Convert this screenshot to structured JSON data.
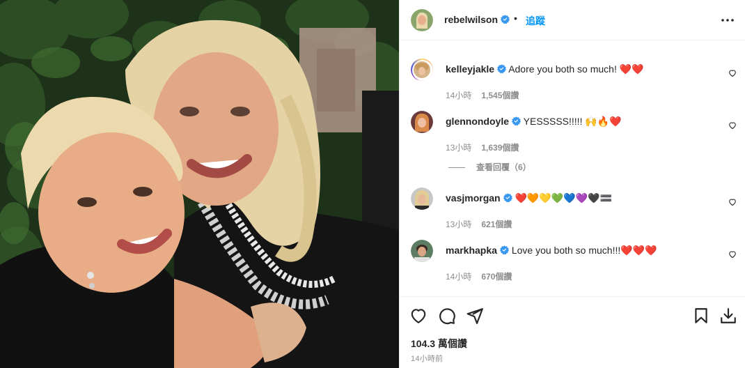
{
  "post": {
    "author": "rebelwilson",
    "follow_label": "追蹤",
    "separator": "•",
    "likes": "104.3 萬個讚",
    "time_ago": "14小時前"
  },
  "comments": [
    {
      "user": "kelleyjakle",
      "text": "Adore you both so much! ❤️❤️",
      "time": "14小時",
      "likes": "1,545個讚"
    },
    {
      "user": "glennondoyle",
      "text": "YESSSSS!!!!! 🙌🔥❤️",
      "time": "13小時",
      "likes": "1,639個讚"
    },
    {
      "user": "vasjmorgan",
      "text": "❤️🧡💛💚💙💜🖤🟰",
      "time": "13小時",
      "likes": "621個讚"
    },
    {
      "user": "markhapka",
      "text": "Love you both so much!!!❤️❤️❤️",
      "time": "14小時",
      "likes": "670個讚"
    }
  ],
  "view_replies_label": "查看回覆（6）",
  "colors": {
    "accent": "#0095f6",
    "verified": "#3897f0",
    "muted": "#8e8e8e",
    "text": "#262626"
  },
  "icons": [
    "verified-badge-icon",
    "more-options-icon",
    "heart-icon",
    "comment-icon",
    "share-icon",
    "bookmark-icon",
    "download-icon"
  ]
}
